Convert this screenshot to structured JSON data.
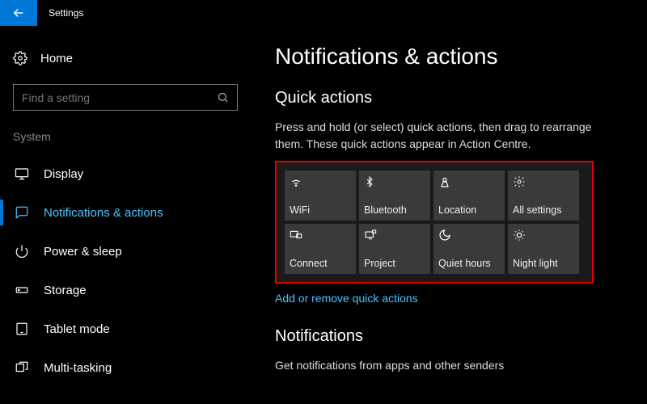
{
  "window": {
    "title": "Settings"
  },
  "sidebar": {
    "home": "Home",
    "search_placeholder": "Find a setting",
    "category": "System",
    "items": [
      {
        "label": "Display"
      },
      {
        "label": "Notifications & actions"
      },
      {
        "label": "Power & sleep"
      },
      {
        "label": "Storage"
      },
      {
        "label": "Tablet mode"
      },
      {
        "label": "Multi-tasking"
      }
    ]
  },
  "main": {
    "title": "Notifications & actions",
    "quick_actions": {
      "heading": "Quick actions",
      "description": "Press and hold (or select) quick actions, then drag to rearrange them. These quick actions appear in Action Centre.",
      "tiles": [
        {
          "label": "WiFi"
        },
        {
          "label": "Bluetooth"
        },
        {
          "label": "Location"
        },
        {
          "label": "All settings"
        },
        {
          "label": "Connect"
        },
        {
          "label": "Project"
        },
        {
          "label": "Quiet hours"
        },
        {
          "label": "Night light"
        }
      ],
      "link": "Add or remove quick actions"
    },
    "notifications": {
      "heading": "Notifications",
      "sub": "Get notifications from apps and other senders"
    }
  }
}
